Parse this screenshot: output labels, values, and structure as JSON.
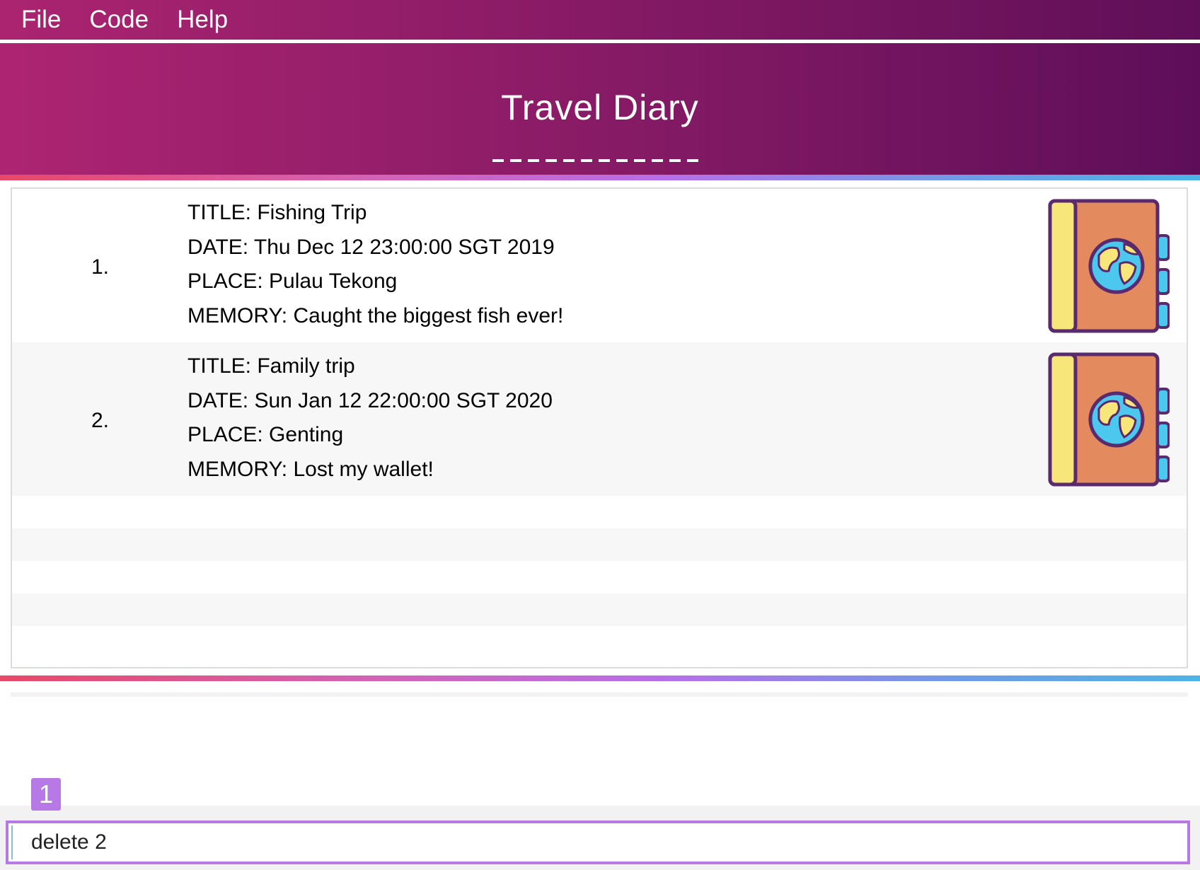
{
  "menu": {
    "items": [
      {
        "label": "File"
      },
      {
        "label": "Code"
      },
      {
        "label": "Help"
      }
    ]
  },
  "header": {
    "title": "Travel Diary",
    "underline": "-------------"
  },
  "entries": [
    {
      "index": "1.",
      "title": "TITLE: Fishing Trip",
      "date": "DATE: Thu Dec 12 23:00:00 SGT 2019",
      "place": "PLACE: Pulau Tekong",
      "memory": "MEMORY: Caught the biggest fish ever!",
      "icon": "travel-diary-globe-icon"
    },
    {
      "index": "2.",
      "title": "TITLE: Family trip",
      "date": "DATE: Sun Jan 12 22:00:00 SGT 2020",
      "place": "PLACE: Genting",
      "memory": "MEMORY: Lost my wallet!",
      "icon": "travel-diary-globe-icon"
    }
  ],
  "result_display": {
    "text": ""
  },
  "badge": {
    "label": "1"
  },
  "command": {
    "value": "delete 2",
    "placeholder": ""
  },
  "colors": {
    "menu_gradient_start": "#ab2470",
    "menu_gradient_end": "#5f0f58",
    "accent_purple": "#b679e6",
    "rainbow_start": "#e84868",
    "rainbow_end": "#4cb4e6",
    "book_orange": "#e38a5f",
    "book_spine_yellow": "#f7e77a",
    "book_tabs_blue": "#4cc7ee",
    "outline_purple": "#5a2a6e"
  }
}
